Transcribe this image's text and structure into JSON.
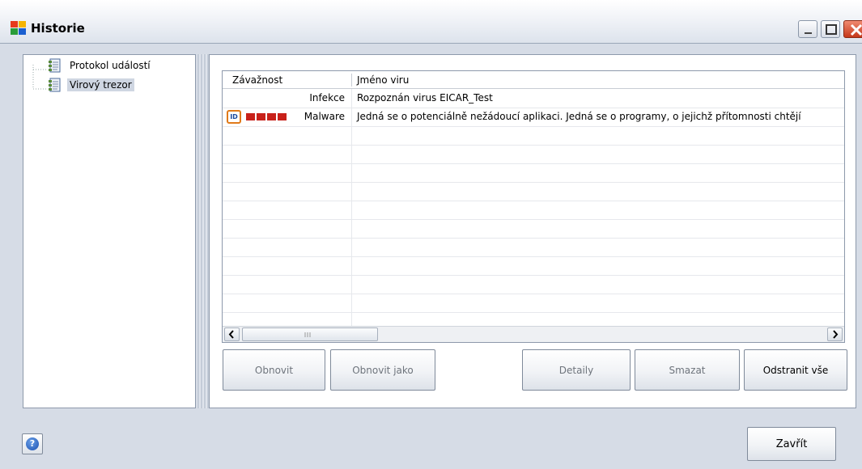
{
  "window": {
    "title": "Historie",
    "controls": [
      "minimize-icon",
      "maximize-icon",
      "close-icon"
    ]
  },
  "tree": {
    "items": [
      {
        "label": "Protokol událostí",
        "selected": false
      },
      {
        "label": "Virový trezor",
        "selected": true
      }
    ]
  },
  "list": {
    "columns": [
      "Závažnost",
      "Jméno viru"
    ],
    "rows": [
      {
        "severity": "Infekce",
        "name": "Rozpoznán virus EICAR_Test",
        "icons": []
      },
      {
        "severity": "Malware",
        "name": "Jedná se o potenciálně nežádoucí aplikaci. Jedná se o programy, o jejichž přítomnosti chtějí",
        "icons": [
          "id-icon",
          "severity-squares"
        ]
      }
    ],
    "id_badge": "ID"
  },
  "buttons": {
    "obnovit": "Obnovit",
    "obnovit_jako": "Obnovit jako",
    "detaily": "Detaily",
    "smazat": "Smazat",
    "odstranit_vse": "Odstranit vše",
    "zavrit": "Zavřít",
    "help": "?"
  },
  "colors": {
    "severity_red": "#c8211a",
    "id_icon_border": "#e07a1a"
  }
}
